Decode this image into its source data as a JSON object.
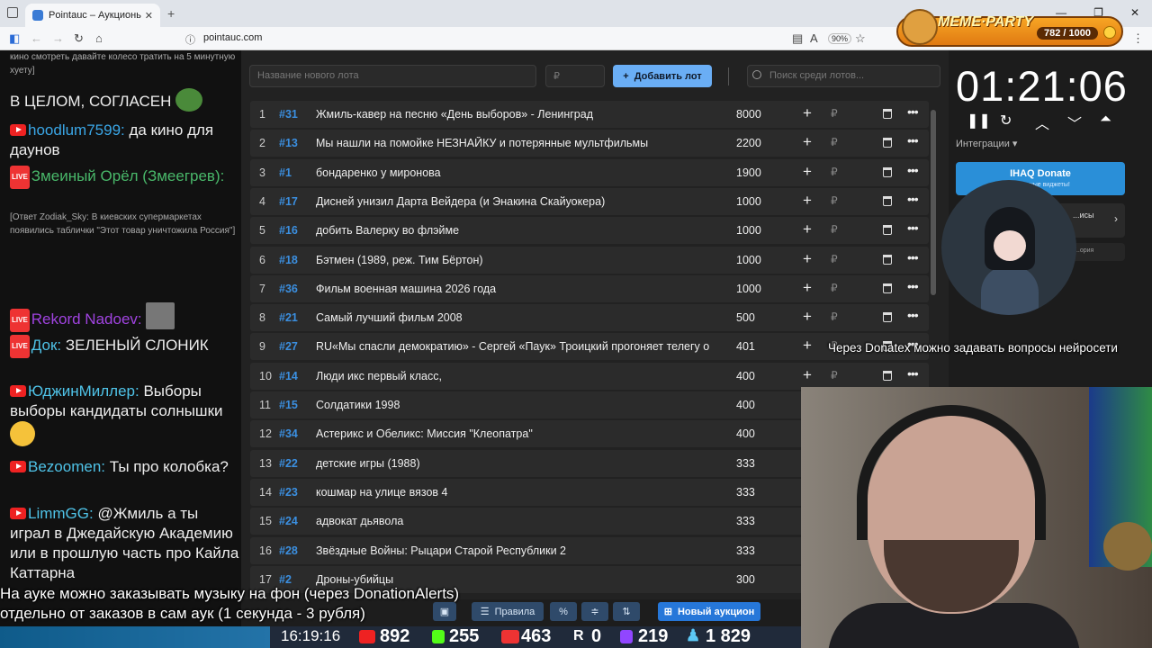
{
  "browser": {
    "tab_title": "Pointauc – Аукционы, лотерея",
    "url": "pointauc.com",
    "zoom": "90%"
  },
  "overlay": {
    "meme_title": "MEME·PARTY",
    "meme_count": "782 / 1000"
  },
  "chat": {
    "m1": "кино смотреть давайте колесо тратить на 5 минутную хуету]",
    "m2": "В ЦЕЛОМ, СОГЛАСЕН",
    "m3_user": "hoodlum7599:",
    "m3_text": " да кино для даунов",
    "m4_user": "Змеиный Орёл (Змеегрев):",
    "m5": "[Ответ Zodiak_Sky: В киевских супермаркетах появились таблички \"Этот товар уничтожила Россия\"]",
    "m6_user": "Rekord Nadoev:",
    "m7_user": "Док:",
    "m7_text": " ЗЕЛЕНЫЙ СЛОНИК",
    "m8_user": "ЮджинМиллер:",
    "m8_text": " Выборы выборы кандидаты солнышки",
    "m9_user": "Bezoomen:",
    "m9_text": " Ты про колобка?",
    "m10_user": "LimmGG:",
    "m10_text": " @Жмиль а ты играл в Джедайскую Академию или в прошлую часть про Кайла Каттарна"
  },
  "toolbar": {
    "lot_placeholder": "Название нового лота",
    "amount_placeholder": "₽",
    "add_label": "Добавить лот",
    "search_placeholder": "Поиск среди лотов..."
  },
  "lots": [
    {
      "n": "1",
      "id": "#31",
      "name": "Жмиль-кавер на песню «День выборов» - Ленинград",
      "amount": "8000"
    },
    {
      "n": "2",
      "id": "#13",
      "name": "Мы нашли на помойке НЕЗНАЙКУ и потерянные мультфильмы",
      "amount": "2200"
    },
    {
      "n": "3",
      "id": "#1",
      "name": "бондаренко у миронова",
      "amount": "1900"
    },
    {
      "n": "4",
      "id": "#17",
      "name": "Дисней унизил Дарта Вейдера (и Энакина Скайуокера)",
      "amount": "1000"
    },
    {
      "n": "5",
      "id": "#16",
      "name": "добить Валерку во флэйме",
      "amount": "1000"
    },
    {
      "n": "6",
      "id": "#18",
      "name": "Бэтмен (1989, реж. Тим Бёртон)",
      "amount": "1000"
    },
    {
      "n": "7",
      "id": "#36",
      "name": "Фильм военная машина 2026 года",
      "amount": "1000"
    },
    {
      "n": "8",
      "id": "#21",
      "name": "Самый лучший фильм 2008",
      "amount": "500"
    },
    {
      "n": "9",
      "id": "#27",
      "name": "RU«Мы спасли демократию» - Сергей «Паук» Троицкий прогоняет телегу о",
      "amount": "401"
    },
    {
      "n": "10",
      "id": "#14",
      "name": "Люди икс первый класс,",
      "amount": "400"
    },
    {
      "n": "11",
      "id": "#15",
      "name": "Солдатики 1998",
      "amount": "400"
    },
    {
      "n": "12",
      "id": "#34",
      "name": "Астерикс и Обеликс: Миссия \"Клеопатра\"",
      "amount": "400"
    },
    {
      "n": "13",
      "id": "#22",
      "name": "детские игры (1988)",
      "amount": "333"
    },
    {
      "n": "14",
      "id": "#23",
      "name": "кошмар на улице вязов 4",
      "amount": "333"
    },
    {
      "n": "15",
      "id": "#24",
      "name": "адвокат дьявола",
      "amount": "333"
    },
    {
      "n": "16",
      "id": "#28",
      "name": "Звёздные Войны: Рыцари Старой Республики 2",
      "amount": "333"
    },
    {
      "n": "17",
      "id": "#2",
      "name": "Дроны-убийцы",
      "amount": "300"
    }
  ],
  "currency_symbol": "₽",
  "bottom": {
    "rules_label": "Правила",
    "percent_label": "%",
    "new_auction_label": "Новый аукцион"
  },
  "right": {
    "timer": "01:21:06",
    "integrations_label": "Интеграции",
    "donate_title": "IHAQ Donate",
    "donate_sub": "...кальные виджеты!",
    "card2_text": "...исы",
    "card3_text": "...ория"
  },
  "tickers": {
    "line1": "На ауке можно заказывать музыку на фон (через DonationAlerts)",
    "line2": "отдельно от заказов в сам аук (1 секунда - 3 рубля)",
    "right": "Через Donatex можно задавать вопросы нейросети"
  },
  "stats": {
    "clock": "16:19:16",
    "youtube": "892",
    "kick": "255",
    "vk_live": "463",
    "rutube": "0",
    "twitch": "219",
    "total": "1 829"
  },
  "colors": {
    "accent_blue": "#3b8fe0",
    "add_button": "#6aaef5",
    "new_auction": "#2677d9"
  }
}
